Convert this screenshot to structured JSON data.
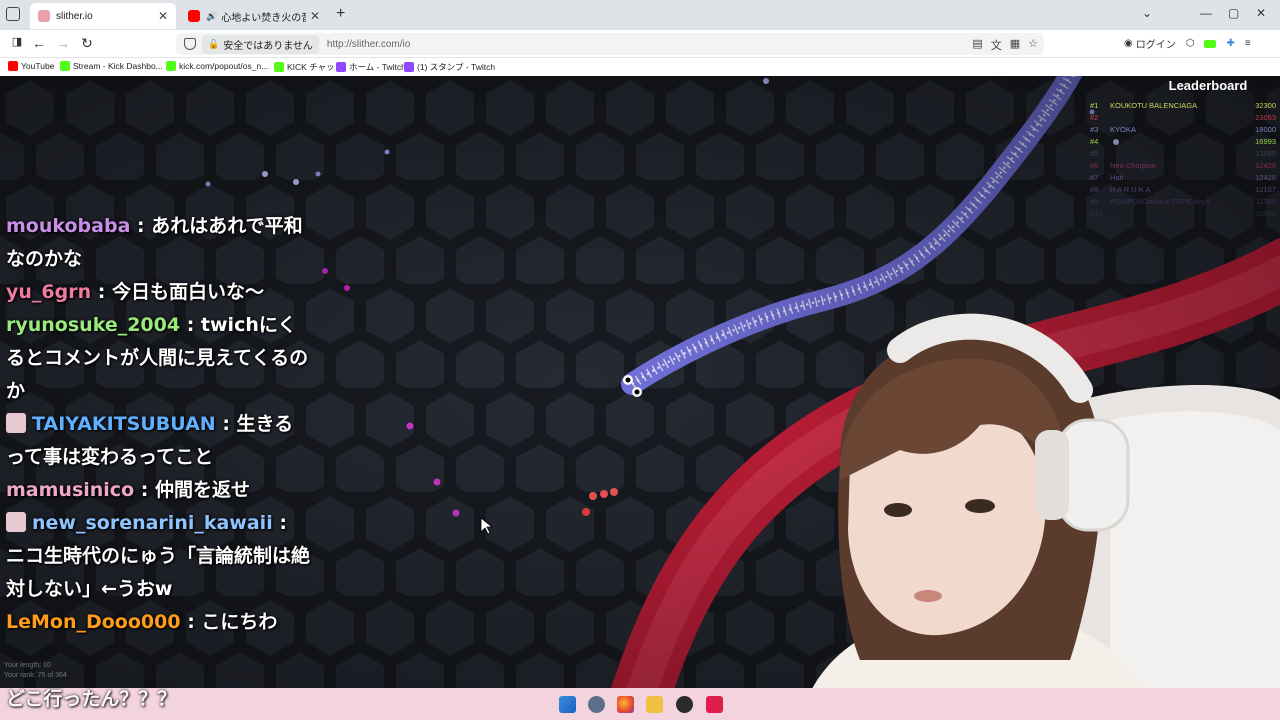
{
  "browser": {
    "tabs": [
      {
        "title": "slither.io",
        "active": true,
        "favicon_color": "#e9a0a8"
      },
      {
        "title": "心地よい焚き火の音でくつろぎ",
        "active": false,
        "favicon_color": "#ff0000"
      }
    ],
    "security_label": "安全ではありません",
    "url": "http://slither.com/io",
    "login_label": "ログイン",
    "bookmarks": [
      {
        "label": "YouTube",
        "icon_color": "#ff0000"
      },
      {
        "label": "Stream - Kick Dashbo...",
        "icon_color": "#53fc18"
      },
      {
        "label": "kick.com/popout/os_n...",
        "icon_color": "#53fc18"
      },
      {
        "label": "KICK チャット",
        "icon_color": "#53fc18"
      },
      {
        "label": "ホーム - Twitch",
        "icon_color": "#9146ff"
      },
      {
        "label": "(1) スタンプ - Twitch",
        "icon_color": "#9146ff"
      }
    ]
  },
  "leaderboard": {
    "title": "Leaderboard",
    "rows": [
      {
        "rank": "#1",
        "name": "KOUKOTU BALENCIAGA",
        "score": "32300",
        "color": "#ccd65a"
      },
      {
        "rank": "#2",
        "name": "",
        "score": "23053",
        "color": "#c23a4e"
      },
      {
        "rank": "#3",
        "name": "KYOKA",
        "score": "18000",
        "color": "#7d86c9"
      },
      {
        "rank": "#4",
        "name": "",
        "score": "16993",
        "color": "#9ad14b"
      },
      {
        "rank": "#5",
        "name": "",
        "score": "13085",
        "color": "#4a4f6a"
      },
      {
        "rank": "#6",
        "name": "Neo Chmpion",
        "score": "12426",
        "color": "#a0356b"
      },
      {
        "rank": "#7",
        "name": "Hati",
        "score": "12426",
        "color": "#7d5aa8"
      },
      {
        "rank": "#8",
        "name": "H A R U K A",
        "score": "12107",
        "color": "#6a4b86"
      },
      {
        "rank": "#9",
        "name": "POMPOKOstikKe°FEPE days",
        "score": "11783",
        "color": "#56408a"
      },
      {
        "rank": "#10",
        "name": "",
        "score": "10650",
        "color": "#3c3f57"
      }
    ]
  },
  "game_status": {
    "your_length": "Your length: 10",
    "your_rank": "Your rank: 75 of 364"
  },
  "chat": [
    {
      "user": "moukobaba",
      "user_color": "#c98ee6",
      "badge": false,
      "text": "あれはあれで平和なのかな"
    },
    {
      "user": "yu_6grn",
      "user_color": "#f07aa0",
      "badge": false,
      "text": "今日も面白いな〜"
    },
    {
      "user": "ryunosuke_2004",
      "user_color": "#9bea7e",
      "badge": false,
      "text": "twichにくるとコメントが人間に見えてくるのか"
    },
    {
      "user": "TAIYAKITSUBUAN",
      "user_color": "#5fb0ff",
      "badge": true,
      "text": "生きるって事は変わるってこと"
    },
    {
      "user": "mamusinico",
      "user_color": "#f0a8c8",
      "badge": false,
      "text": "仲間を返せ"
    },
    {
      "user": "new_sorenarini_kawaii",
      "user_color": "#8fc3ff",
      "badge": true,
      "text": "ニコ生時代のにゅう「言論統制は絶対しない」←うおw"
    },
    {
      "user": "LeMon_Dooo000",
      "user_color": "#ff9c1a",
      "badge": false,
      "text": "こにちわ"
    }
  ],
  "overlay_partial_text": "どこ行ったん？？？",
  "colors": {
    "game_bg": "#181b21",
    "hex_fill": "#252932",
    "snake_blue": "#6e6fd8",
    "snake_red": "#d2253f",
    "taskbar": "#f3d3dd"
  },
  "icons": [
    "tab-list-icon",
    "close-icon",
    "plus-icon",
    "back-icon",
    "forward-icon",
    "reload-icon",
    "shield-icon",
    "lock-icon",
    "star-icon",
    "translate-icon",
    "account-icon",
    "extension-icon",
    "menu-icon",
    "windows-start-icon",
    "settings-icon",
    "firefox-icon",
    "folder-icon",
    "obs-icon",
    "stream-app-icon"
  ]
}
